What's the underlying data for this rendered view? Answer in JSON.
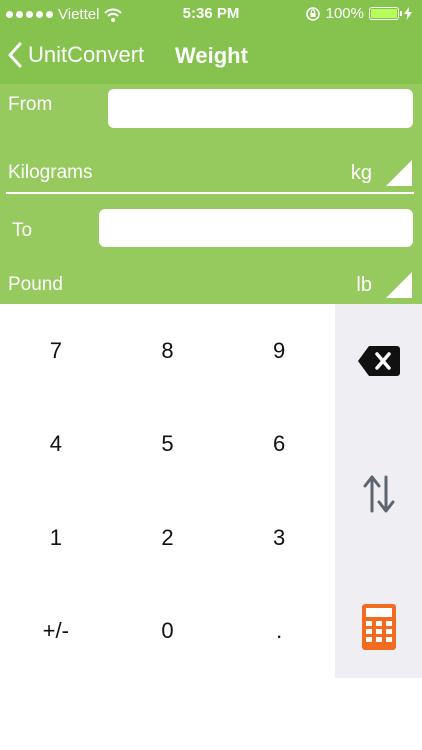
{
  "status_bar": {
    "carrier": "Viettel",
    "time": "5:36 PM",
    "battery_percent": "100%",
    "battery_level": 1.0
  },
  "nav": {
    "back_label": "UnitConvert",
    "title": "Weight"
  },
  "from": {
    "label": "From",
    "value": "",
    "unit_name": "Kilograms",
    "unit_abbr": "kg"
  },
  "to": {
    "label": "To",
    "value": "",
    "unit_name": "Pound",
    "unit_abbr": "lb"
  },
  "keypad": {
    "keys": [
      "7",
      "8",
      "9",
      "4",
      "5",
      "6",
      "1",
      "2",
      "3",
      "+/-",
      "0",
      "."
    ],
    "side_buttons": [
      "backspace-icon",
      "swap-icon",
      "calculator-icon"
    ]
  },
  "colors": {
    "nav_green": "#86c24e",
    "panel_green": "#96ca5f",
    "side_bg": "#efeef3",
    "calculator_orange": "#f26b21"
  }
}
